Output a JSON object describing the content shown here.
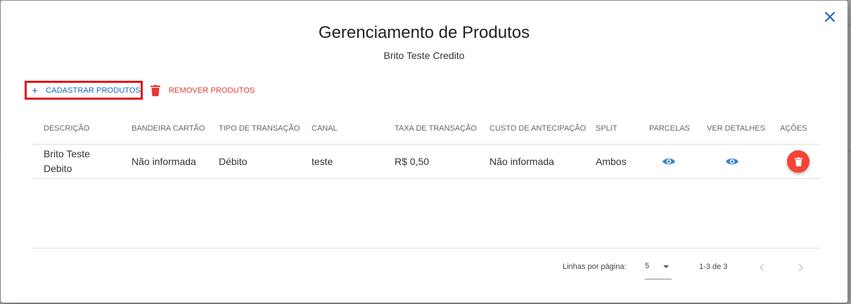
{
  "dialog": {
    "title": "Gerenciamento de Produtos",
    "subtitle": "Brito Teste Credito",
    "close_icon": "close-icon"
  },
  "toolbar": {
    "add_label": "CADASTRAR PRODUTOS",
    "add_icon": "plus-icon",
    "remove_label": "REMOVER PRODUTOS",
    "remove_icon": "trash-icon"
  },
  "table": {
    "columns": [
      "DESCRIÇÃO",
      "BANDEIRA CARTÃO",
      "TIPO DE TRANSAÇÃO",
      "CANAL",
      "TAXA DE TRANSAÇÃO",
      "CUSTO DE ANTECIPAÇÃO",
      "SPLIT",
      "PARCELAS",
      "VER DETALHES",
      "AÇÕES"
    ],
    "rows": [
      {
        "descricao": "Brito Teste Debito",
        "bandeira": "Não informada",
        "tipo": "Débito",
        "canal": "teste",
        "taxa": "R$ 0,50",
        "custo": "Não informada",
        "split": "Ambos",
        "parcelas_icon": "eye-icon",
        "detalhes_icon": "eye-icon",
        "acoes_icon": "trash-icon"
      }
    ]
  },
  "pagination": {
    "rows_per_page_label": "Linhas por página:",
    "rows_per_page_value": "5",
    "range": "1-3 de 3"
  },
  "colors": {
    "primary": "#1565c0",
    "danger": "#e53935",
    "eye": "#3d85c6",
    "highlight_border": "#e0141e"
  }
}
